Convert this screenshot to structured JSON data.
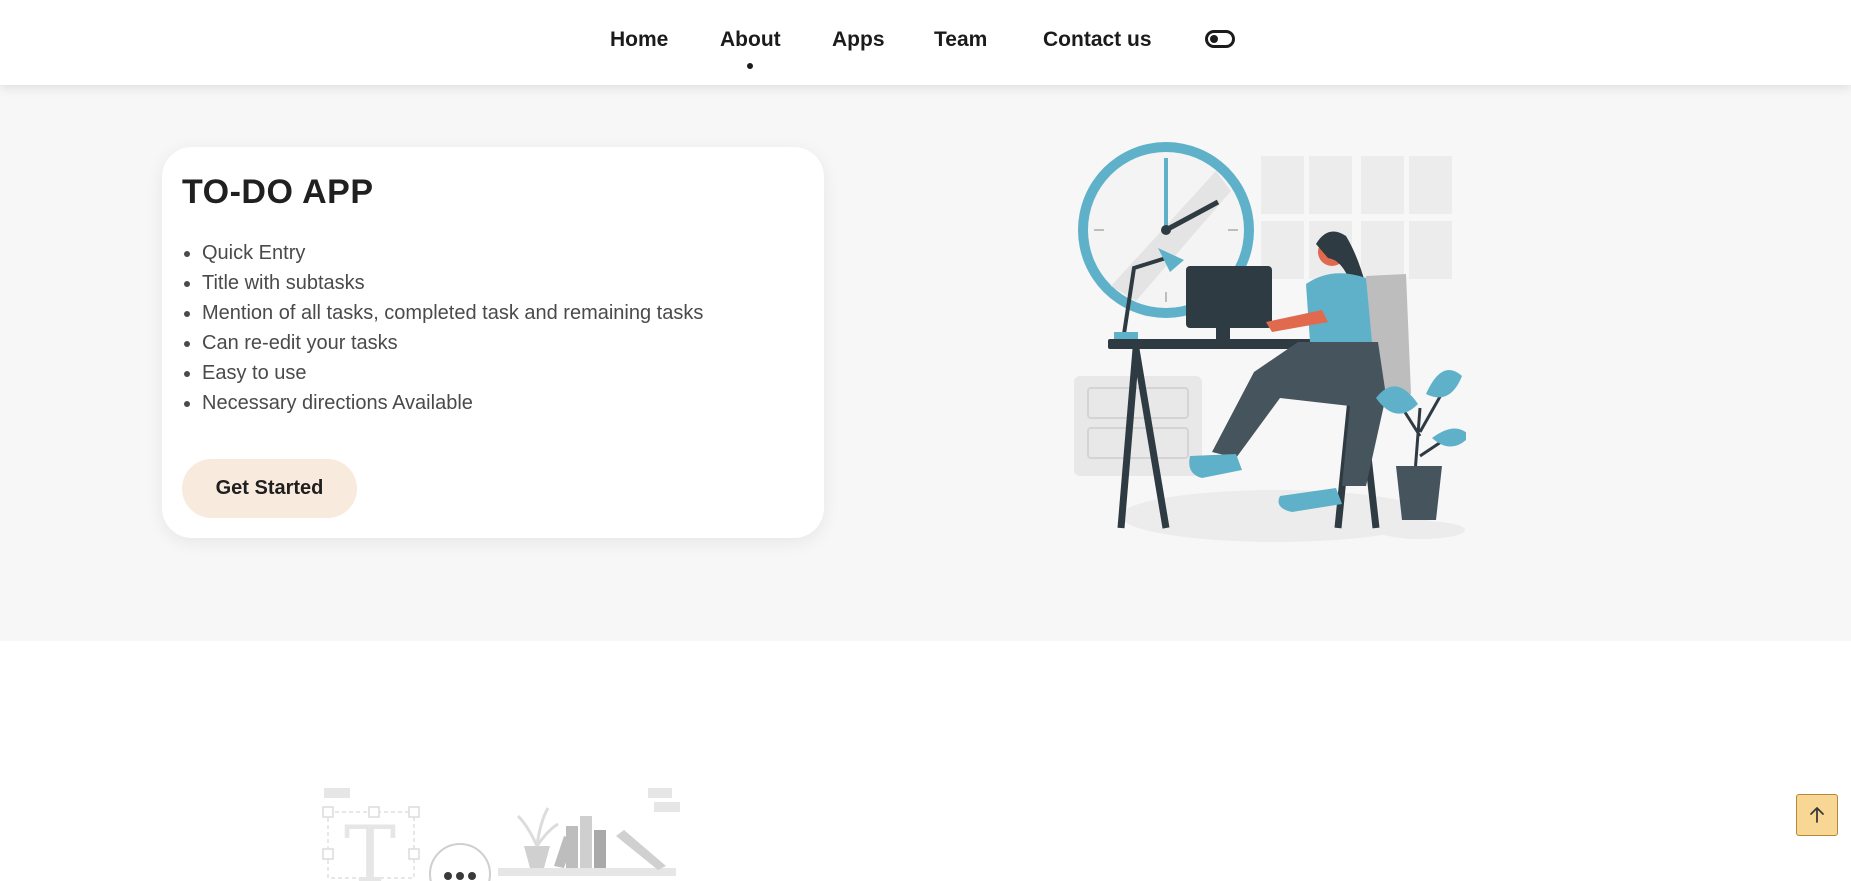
{
  "nav": {
    "items": [
      {
        "label": "Home"
      },
      {
        "label": "About"
      },
      {
        "label": "Apps"
      },
      {
        "label": "Team"
      },
      {
        "label": "Contact us"
      }
    ],
    "active": "About",
    "theme_toggle_icon": "toggle-switch-icon"
  },
  "card": {
    "title": "TO-DO APP",
    "features": [
      "Quick Entry",
      "Title with subtasks",
      "Mention of all tasks, completed task and remaining tasks",
      "Can re-edit your tasks",
      "Easy to use",
      "Necessary directions Available"
    ],
    "cta_label": "Get Started"
  },
  "illustrations": {
    "hero": "woman-at-desk-illustration",
    "bottom": "text-editor-shelf-illustration"
  },
  "scroll_top": {
    "icon": "arrow-up-icon"
  },
  "colors": {
    "accent_blue": "#5fb1c9",
    "cta_bg": "#f8eadd",
    "scroll_top_bg": "#f8d693",
    "nav_text": "#1b1b1b"
  }
}
